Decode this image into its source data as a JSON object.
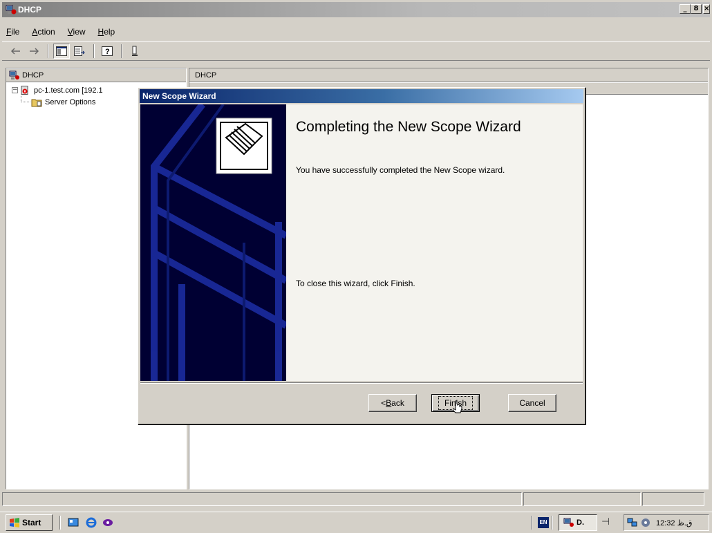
{
  "window": {
    "title": "DHCP",
    "controls": {
      "minimize": "_",
      "maximize": "8",
      "close": "×"
    }
  },
  "menu": {
    "items": [
      {
        "label": "File",
        "accel": "F",
        "rest": "ile"
      },
      {
        "label": "Action",
        "accel": "A",
        "rest": "ction"
      },
      {
        "label": "View",
        "accel": "V",
        "rest": "iew"
      },
      {
        "label": "Help",
        "accel": "H",
        "rest": "elp"
      }
    ]
  },
  "toolbar": {
    "icons": [
      "back-arrow",
      "forward-arrow",
      "show-hide-console-tree",
      "export-list",
      "help",
      "server-status"
    ]
  },
  "tree": {
    "header": "DHCP",
    "root": "DHCP",
    "server": "pc-1.test.com [192.1",
    "child": "Server Options"
  },
  "right_pane": {
    "header": "DHCP"
  },
  "wizard": {
    "title": "New Scope Wizard",
    "heading": "Completing the New Scope Wizard",
    "message": "You have successfully completed the New Scope wizard.",
    "close_hint": "To close this wizard, click Finish.",
    "buttons": {
      "back": {
        "accel": "B",
        "rest": "ack",
        "prefix": "< "
      },
      "finish": "Finish",
      "cancel": "Cancel"
    }
  },
  "taskbar": {
    "start": "Start",
    "task_label": "D.",
    "lang": "EN",
    "clock": "12:32 ق.ظ"
  },
  "colors": {
    "desktop": "#3a6ea5",
    "title_active": "#0a246a",
    "wizard_side": "#000030",
    "face": "#d4d0c8"
  }
}
